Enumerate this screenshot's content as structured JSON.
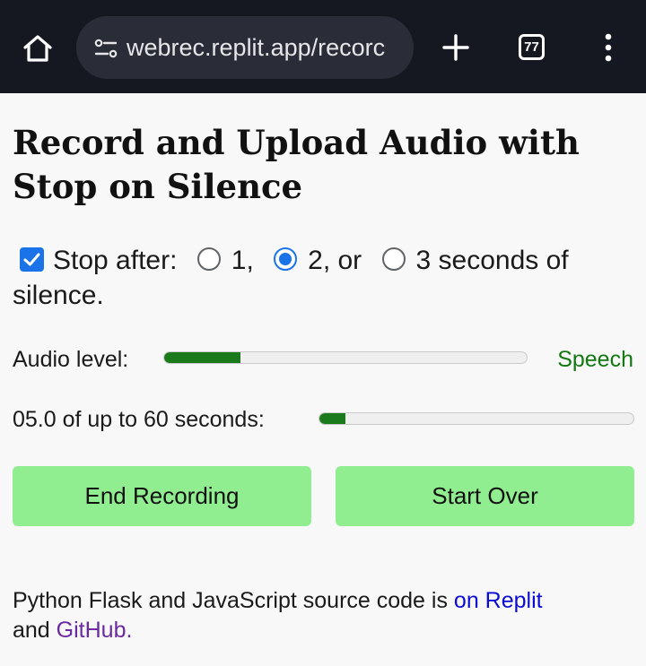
{
  "browser": {
    "url": "webrec.replit.app/recorc",
    "tab_count": "77"
  },
  "page": {
    "title": "Record and Upload Audio with Stop on Silence",
    "stop_after_label": "Stop after:",
    "stop_after_checked": true,
    "options": [
      {
        "label": "1,",
        "checked": false
      },
      {
        "label": "2, or",
        "checked": true
      },
      {
        "label": "3 seconds of silence.",
        "checked": false
      }
    ],
    "audio_level_label": "Audio level:",
    "audio_level_fraction": 0.21,
    "speech_status": "Speech",
    "timer_text": "05.0 of up to 60 seconds:",
    "timer_fraction": 0.083,
    "end_recording_label": "End Recording",
    "start_over_label": "Start Over",
    "footer_prefix": "Python Flask and JavaScript source code is ",
    "footer_link_replit": "on Replit",
    "footer_middle": "and ",
    "footer_link_github": "GitHub."
  },
  "colors": {
    "button_bg": "#90ee90",
    "progress_fill": "#1b7a1b",
    "speech_text": "#127912",
    "accent": "#1a73e8"
  }
}
